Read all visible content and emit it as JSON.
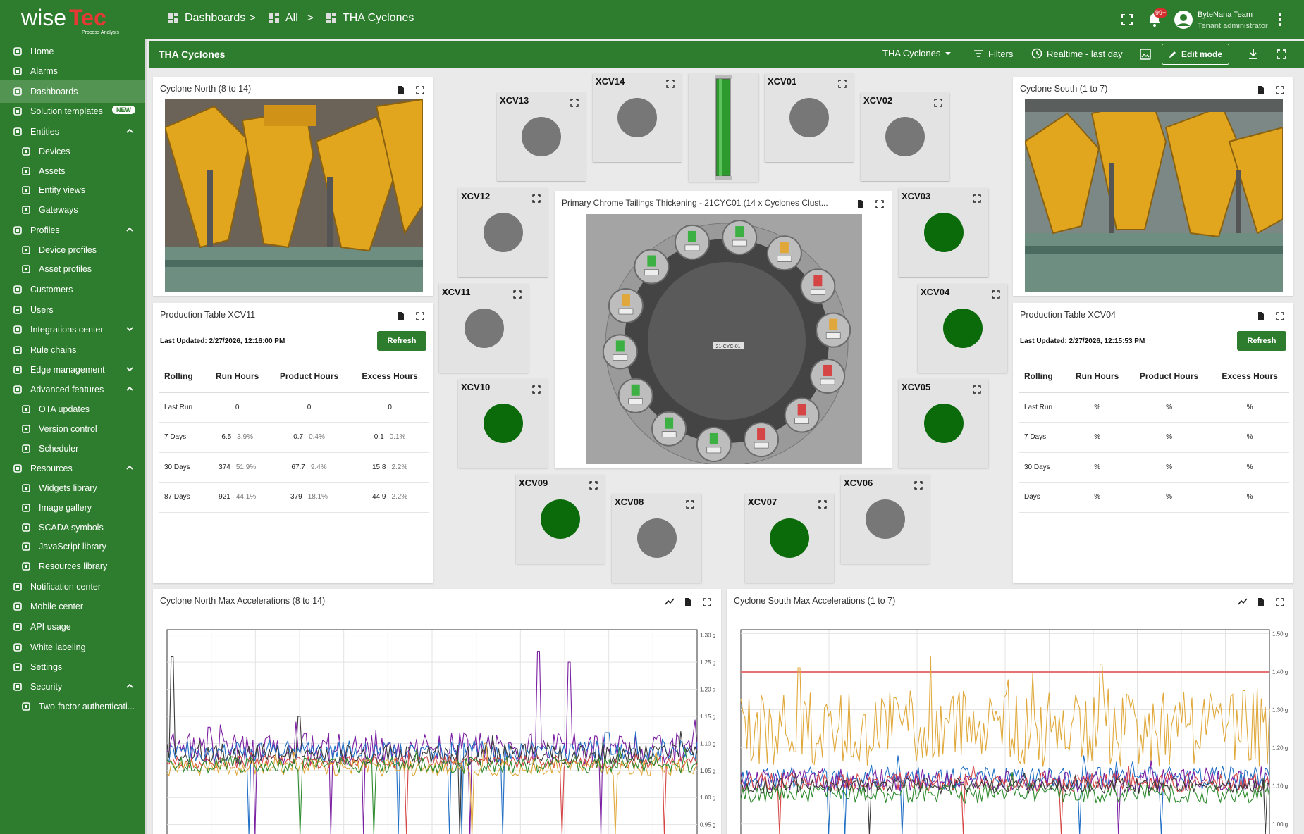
{
  "brand": {
    "logo_text_a": "wise",
    "logo_text_b": "Tec",
    "logo_sub": "Process Analysis",
    "color": "#2e7d2e"
  },
  "breadcrumb": [
    {
      "label": "Dashboards"
    },
    {
      "label": "All"
    },
    {
      "label": "THA Cyclones"
    }
  ],
  "breadcrumb_sep": ">",
  "notifications": {
    "count": "99+"
  },
  "user": {
    "name": "ByteNana Team",
    "role": "Tenant administrator"
  },
  "sidebar": {
    "items": [
      {
        "label": "Home",
        "icon": "home-icon"
      },
      {
        "label": "Alarms",
        "icon": "alarm-icon"
      },
      {
        "label": "Dashboards",
        "icon": "dashboard-icon",
        "active": true
      },
      {
        "label": "Solution templates",
        "icon": "templates-icon",
        "badge": "NEW"
      },
      {
        "label": "Entities",
        "icon": "entities-icon",
        "expanded": true
      },
      {
        "label": "Devices",
        "icon": "devices-icon",
        "sub": true
      },
      {
        "label": "Assets",
        "icon": "assets-icon",
        "sub": true
      },
      {
        "label": "Entity views",
        "icon": "entity-views-icon",
        "sub": true
      },
      {
        "label": "Gateways",
        "icon": "gateways-icon",
        "sub": true
      },
      {
        "label": "Profiles",
        "icon": "profiles-icon",
        "expanded": true
      },
      {
        "label": "Device profiles",
        "icon": "device-profiles-icon",
        "sub": true
      },
      {
        "label": "Asset profiles",
        "icon": "asset-profiles-icon",
        "sub": true
      },
      {
        "label": "Customers",
        "icon": "customers-icon"
      },
      {
        "label": "Users",
        "icon": "users-icon"
      },
      {
        "label": "Integrations center",
        "icon": "integrations-icon",
        "expanded": false
      },
      {
        "label": "Rule chains",
        "icon": "rule-chains-icon"
      },
      {
        "label": "Edge management",
        "icon": "edge-icon",
        "expanded": false
      },
      {
        "label": "Advanced features",
        "icon": "advanced-icon",
        "expanded": true
      },
      {
        "label": "OTA updates",
        "icon": "ota-icon",
        "sub": true
      },
      {
        "label": "Version control",
        "icon": "version-icon",
        "sub": true
      },
      {
        "label": "Scheduler",
        "icon": "scheduler-icon",
        "sub": true
      },
      {
        "label": "Resources",
        "icon": "resources-icon",
        "expanded": true
      },
      {
        "label": "Widgets library",
        "icon": "widgets-icon",
        "sub": true
      },
      {
        "label": "Image gallery",
        "icon": "image-gallery-icon",
        "sub": true
      },
      {
        "label": "SCADA symbols",
        "icon": "scada-icon",
        "sub": true
      },
      {
        "label": "JavaScript library",
        "icon": "javascript-icon",
        "sub": true
      },
      {
        "label": "Resources library",
        "icon": "resources-library-icon",
        "sub": true
      },
      {
        "label": "Notification center",
        "icon": "notification-icon"
      },
      {
        "label": "Mobile center",
        "icon": "mobile-icon"
      },
      {
        "label": "API usage",
        "icon": "api-icon"
      },
      {
        "label": "White labeling",
        "icon": "white-label-icon"
      },
      {
        "label": "Settings",
        "icon": "settings-icon"
      },
      {
        "label": "Security",
        "icon": "security-icon",
        "expanded": true
      },
      {
        "label": "Two-factor authenticati...",
        "icon": "two-factor-icon",
        "sub": true
      }
    ]
  },
  "dashboard": {
    "title": "THA Cyclones",
    "state_select": "THA Cyclones",
    "filters_label": "Filters",
    "timewindow_label": "Realtime - last day",
    "edit_label": "Edit mode"
  },
  "widgets": {
    "north_image": {
      "title": "Cyclone North (8 to 14)"
    },
    "south_image": {
      "title": "Cyclone South (1 to 7)"
    },
    "center_image": {
      "title": "Primary Chrome Tailings Thickening - 21CYC01 (14 x Cyclones Clust...",
      "center_label": "21-CYC-01"
    },
    "prod_north": {
      "title": "Production Table XCV11",
      "updated": "Last Updated: 2/27/2026, 12:16:00 PM",
      "refresh": "Refresh",
      "headers": [
        "Rolling",
        "Run Hours",
        "Product Hours",
        "Excess Hours"
      ],
      "rows": [
        {
          "label": "Last Run",
          "c1": "0",
          "p1": "",
          "c2": "0",
          "p2": "",
          "c3": "0",
          "p3": ""
        },
        {
          "label": "7 Days",
          "c1": "6.5",
          "p1": "3.9%",
          "c2": "0.7",
          "p2": "0.4%",
          "c3": "0.1",
          "p3": "0.1%"
        },
        {
          "label": "30 Days",
          "c1": "374",
          "p1": "51.9%",
          "c2": "67.7",
          "p2": "9.4%",
          "c3": "15.8",
          "p3": "2.2%"
        },
        {
          "label": "87 Days",
          "c1": "921",
          "p1": "44.1%",
          "c2": "379",
          "p2": "18.1%",
          "c3": "44.9",
          "p3": "2.2%"
        }
      ]
    },
    "prod_south": {
      "title": "Production Table XCV04",
      "updated": "Last Updated: 2/27/2026, 12:15:53 PM",
      "refresh": "Refresh",
      "headers": [
        "Rolling",
        "Run Hours",
        "Product Hours",
        "Excess Hours"
      ],
      "rows": [
        {
          "label": "Last Run",
          "c1": "%",
          "p1": "",
          "c2": "%",
          "p2": "",
          "c3": "%",
          "p3": ""
        },
        {
          "label": "7 Days",
          "c1": "%",
          "p1": "",
          "c2": "%",
          "p2": "",
          "c3": "%",
          "p3": ""
        },
        {
          "label": "30 Days",
          "c1": "%",
          "p1": "",
          "c2": "%",
          "p2": "",
          "c3": "%",
          "p3": ""
        },
        {
          "label": "Days",
          "c1": "%",
          "p1": "",
          "c2": "%",
          "p2": "",
          "c3": "%",
          "p3": ""
        }
      ]
    },
    "chart_north_title": "Cyclone North Max Accelerations (8 to 14)",
    "chart_south_title": "Cyclone South Max Accelerations (1 to 7)"
  },
  "valves": [
    {
      "id": "XCV13",
      "state": "off"
    },
    {
      "id": "XCV14",
      "state": "off"
    },
    {
      "id": "XCV01",
      "state": "off"
    },
    {
      "id": "XCV02",
      "state": "off"
    },
    {
      "id": "XCV12",
      "state": "off"
    },
    {
      "id": "XCV03",
      "state": "on"
    },
    {
      "id": "XCV11",
      "state": "off"
    },
    {
      "id": "XCV04",
      "state": "on"
    },
    {
      "id": "XCV10",
      "state": "on"
    },
    {
      "id": "XCV05",
      "state": "on"
    },
    {
      "id": "XCV09",
      "state": "on"
    },
    {
      "id": "XCV08",
      "state": "off"
    },
    {
      "id": "XCV07",
      "state": "on"
    },
    {
      "id": "XCV06",
      "state": "off"
    }
  ],
  "valve_colors": {
    "on": "#0b6b0b",
    "off": "#777777"
  },
  "chart_data": [
    {
      "type": "line",
      "ylim": [
        0.93,
        1.31
      ],
      "ytick_labels": [
        "0.95 g",
        "1.00 g",
        "1.05 g",
        "1.10 g",
        "1.15 g",
        "1.20 g",
        "1.25 g",
        "1.30 g"
      ],
      "yticks": [
        0.95,
        1.0,
        1.05,
        1.1,
        1.15,
        1.2,
        1.25,
        1.3
      ],
      "grid": true,
      "series": [
        {
          "color": "#7b1fa2",
          "base": 1.09,
          "amp": 0.03,
          "spikes": [
            [
              0.7,
              1.27
            ],
            [
              0.76,
              1.25
            ],
            [
              0.08,
              1.13
            ]
          ]
        },
        {
          "color": "#1f6fc5",
          "base": 1.085,
          "amp": 0.02,
          "spikes": [
            [
              0.83,
              1.12
            ]
          ]
        },
        {
          "color": "#3a3a3a",
          "base": 1.08,
          "amp": 0.02,
          "spikes": [
            [
              0.01,
              1.26
            ],
            [
              0.25,
              1.15
            ]
          ]
        },
        {
          "color": "#d64545",
          "base": 1.065,
          "amp": 0.012,
          "spikes": []
        },
        {
          "color": "#e0a83a",
          "base": 1.055,
          "amp": 0.015,
          "spikes": [
            [
              0.6,
              1.1
            ]
          ]
        },
        {
          "color": "#2e8b2e",
          "base": 1.06,
          "amp": 0.015,
          "spikes": []
        }
      ]
    },
    {
      "type": "line",
      "ylim": [
        0.97,
        1.51
      ],
      "ytick_labels": [
        "1.00 g",
        "1.10 g",
        "1.20 g",
        "1.30 g",
        "1.40 g",
        "1.50 g"
      ],
      "yticks": [
        1.0,
        1.1,
        1.2,
        1.3,
        1.4,
        1.5
      ],
      "threshold": 1.4,
      "threshold_color": "#e57373",
      "grid": true,
      "series": [
        {
          "color": "#e0a83a",
          "base": 1.25,
          "amp": 0.1,
          "spikes": [
            [
              0.68,
              1.42
            ],
            [
              0.11,
              1.41
            ],
            [
              0.95,
              1.35
            ]
          ]
        },
        {
          "color": "#1f6fc5",
          "base": 1.12,
          "amp": 0.03,
          "spikes": []
        },
        {
          "color": "#7b1fa2",
          "base": 1.115,
          "amp": 0.03,
          "spikes": []
        },
        {
          "color": "#d64545",
          "base": 1.11,
          "amp": 0.025,
          "spikes": []
        },
        {
          "color": "#2e8b2e",
          "base": 1.08,
          "amp": 0.025,
          "spikes": []
        },
        {
          "color": "#3a3a3a",
          "base": 1.1,
          "amp": 0.02,
          "spikes": []
        }
      ]
    }
  ]
}
